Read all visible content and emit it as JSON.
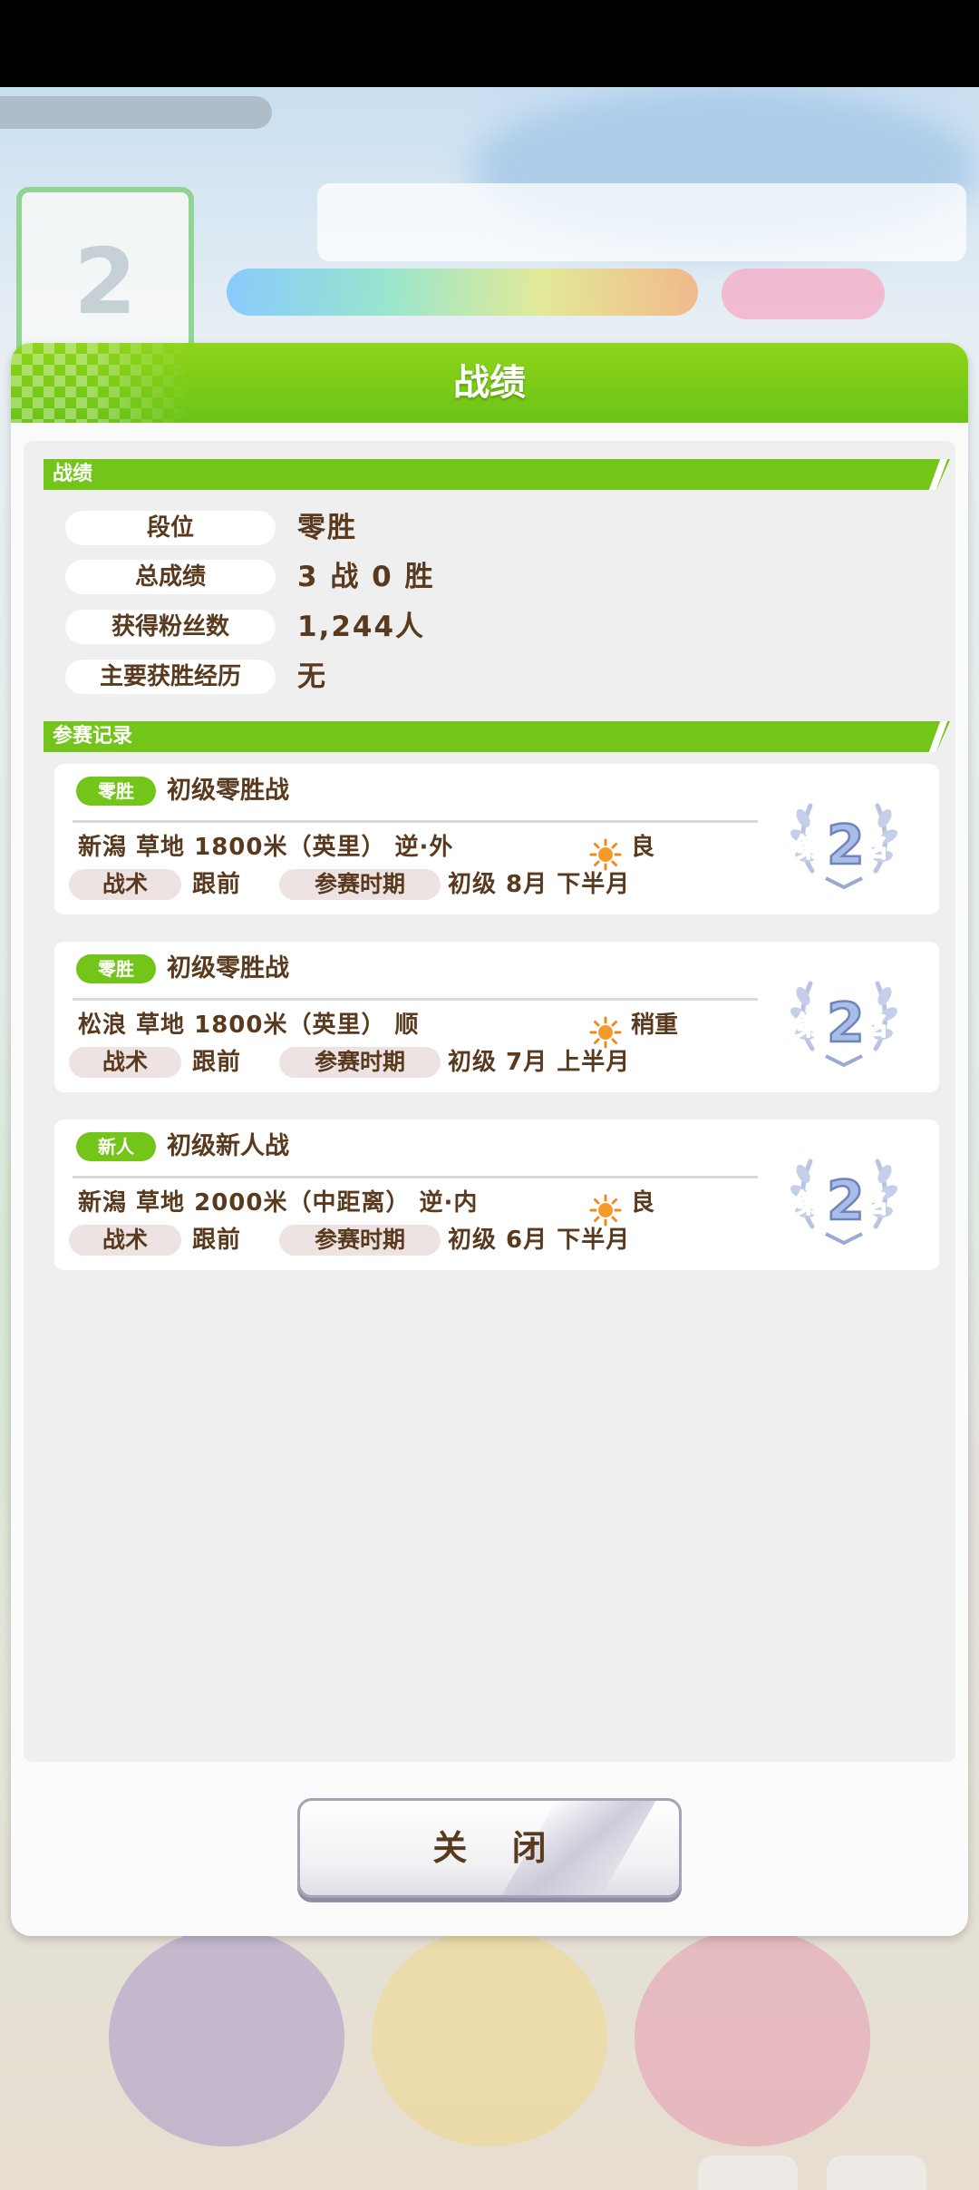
{
  "modal": {
    "title": "战绩",
    "close_label": "关 闭"
  },
  "stats_section": {
    "header": "战绩",
    "rows": [
      {
        "label": "段位",
        "value": "零胜"
      },
      {
        "label": "总成绩",
        "value": "3 战 0 胜"
      },
      {
        "label": "获得粉丝数",
        "value": "1,244人"
      },
      {
        "label": "主要获胜经历",
        "value": "无"
      }
    ]
  },
  "records_section": {
    "header": "参赛记录",
    "races": [
      {
        "badge": "零胜",
        "badge_color": "#73c51a",
        "name": "初级零胜战",
        "detail": "新潟  草地  1800米（英里） 逆·外",
        "weather_icon": "sun-icon",
        "weather": "良",
        "tactic_label": "战术",
        "tactic": "跟前",
        "period_label": "参赛时期",
        "period": "初级  8月  下半月",
        "rank_prefix": "第",
        "rank": "2",
        "rank_suffix": "名"
      },
      {
        "badge": "零胜",
        "badge_color": "#73c51a",
        "name": "初级零胜战",
        "detail": "松浪  草地  1800米（英里） 顺",
        "weather_icon": "sun-icon",
        "weather": "稍重",
        "tactic_label": "战术",
        "tactic": "跟前",
        "period_label": "参赛时期",
        "period": "初级  7月  上半月",
        "rank_prefix": "第",
        "rank": "2",
        "rank_suffix": "名"
      },
      {
        "badge": "新人",
        "badge_color": "#73c51a",
        "name": "初级新人战",
        "detail": "新潟  草地  2000米（中距离） 逆·内",
        "weather_icon": "sun-icon",
        "weather": "良",
        "tactic_label": "战术",
        "tactic": "跟前",
        "period_label": "参赛时期",
        "period": "初级  6月  下半月",
        "rank_prefix": "第",
        "rank": "2",
        "rank_suffix": "名"
      }
    ]
  },
  "background": {
    "turn_number": "2"
  },
  "colors": {
    "accent_green": "#73c51a",
    "text_brown": "#5a3a1e",
    "medal_blue": "#7e92c9"
  }
}
